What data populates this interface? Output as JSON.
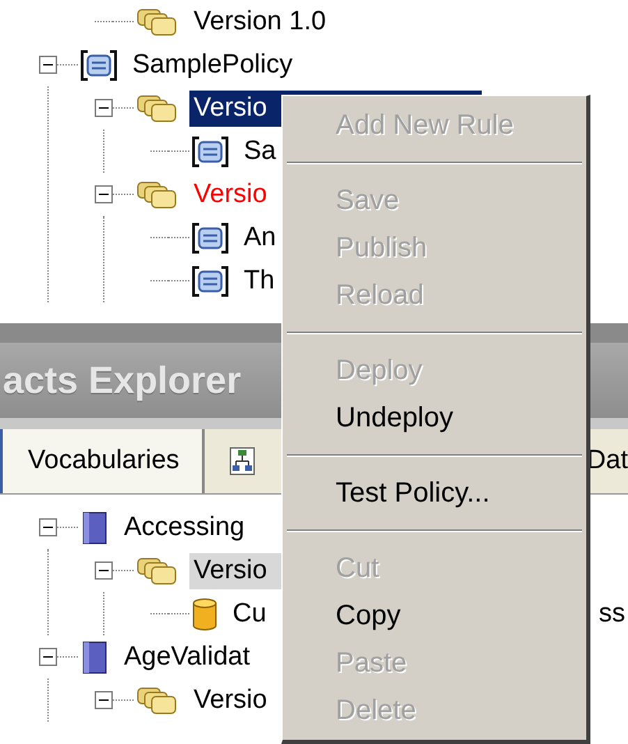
{
  "policy_tree": {
    "focused": true,
    "continued_items": [
      {
        "label": "Version 1.0",
        "kind": "version",
        "selected": false
      }
    ],
    "items": [
      {
        "label": "SamplePolicy",
        "kind": "policy",
        "expanded": true,
        "selected": false,
        "children": [
          {
            "label": "Versio",
            "kind": "version",
            "expanded": true,
            "selected": true,
            "children": [
              {
                "label": "Sa",
                "kind": "rule",
                "selected": false
              }
            ]
          },
          {
            "label": "Versio",
            "kind": "version",
            "expanded": true,
            "selected": false,
            "color": "#ff0000",
            "children": [
              {
                "label": "An",
                "kind": "rule",
                "selected": false
              },
              {
                "label": "Th",
                "kind": "rule",
                "selected": false
              }
            ]
          }
        ]
      }
    ]
  },
  "facts_explorer": {
    "title": "acts Explorer",
    "tabs": [
      {
        "label": "Vocabularies",
        "kind": "text",
        "selected": true
      },
      {
        "kind": "icon",
        "selected": false
      },
      {
        "label": "Dat",
        "kind": "text",
        "selected": false
      }
    ],
    "tree": {
      "focused": false,
      "items": [
        {
          "label": "Accessing",
          "kind": "vocabulary",
          "expanded": true,
          "selected": false,
          "children": [
            {
              "label": "Versio",
              "kind": "version",
              "expanded": true,
              "selected": true,
              "children": [
                {
                  "label": "Cu",
                  "tail": "ss",
                  "kind": "definition",
                  "selected": false
                }
              ]
            }
          ]
        },
        {
          "label": "AgeValidat",
          "kind": "vocabulary",
          "expanded": true,
          "selected": false,
          "children": [
            {
              "label": "Versio",
              "kind": "version",
              "expanded": true,
              "selected": false
            }
          ]
        }
      ]
    }
  },
  "context_menu": [
    {
      "kind": "item",
      "label": "Add New Rule",
      "disabled": true
    },
    {
      "kind": "separator"
    },
    {
      "kind": "item",
      "label": "Save",
      "disabled": true
    },
    {
      "kind": "item",
      "label": "Publish",
      "disabled": true
    },
    {
      "kind": "item",
      "label": "Reload",
      "disabled": true
    },
    {
      "kind": "separator"
    },
    {
      "kind": "item",
      "label": "Deploy",
      "disabled": true
    },
    {
      "kind": "item",
      "label": "Undeploy",
      "disabled": false
    },
    {
      "kind": "separator"
    },
    {
      "kind": "item",
      "label": "Test Policy...",
      "disabled": false
    },
    {
      "kind": "separator"
    },
    {
      "kind": "item",
      "label": "Cut",
      "disabled": true
    },
    {
      "kind": "item",
      "label": "Copy",
      "disabled": false
    },
    {
      "kind": "item",
      "label": "Paste",
      "disabled": true
    },
    {
      "kind": "item",
      "label": "Delete",
      "disabled": true
    }
  ]
}
